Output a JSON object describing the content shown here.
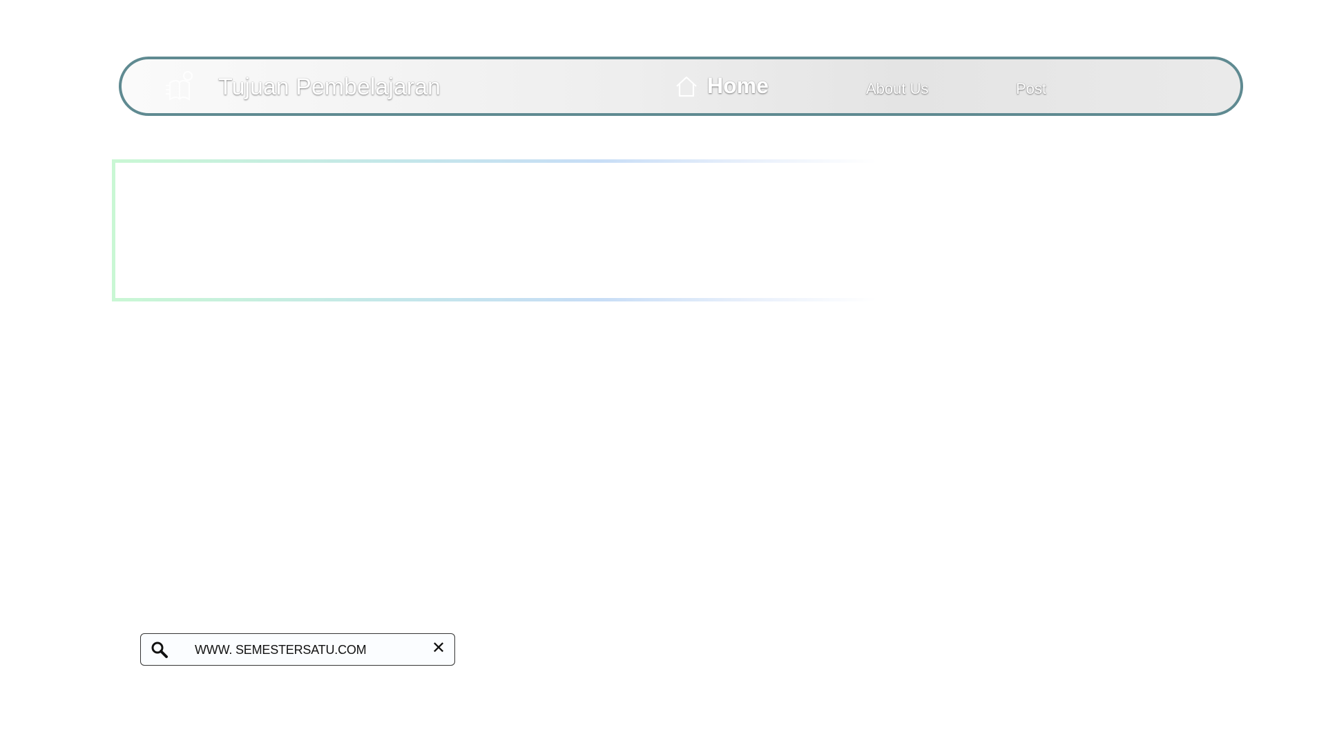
{
  "navbar": {
    "brand_title": "Tujuan Pembelajaran",
    "brand_icon": "reading-book-icon",
    "home_icon": "home-icon",
    "home_label": "Home",
    "about_label": "About Us",
    "post_label": "Post",
    "border_color": "#5f8a91"
  },
  "searchbar": {
    "url_text": "WWW. SEMESTERSATU.COM",
    "search_icon": "search-icon",
    "close_icon": "close-icon",
    "close_glyph": "✕"
  },
  "colors": {
    "frame_gradient_start": "#c9f7d4",
    "frame_gradient_mid": "#c7ddf6"
  }
}
